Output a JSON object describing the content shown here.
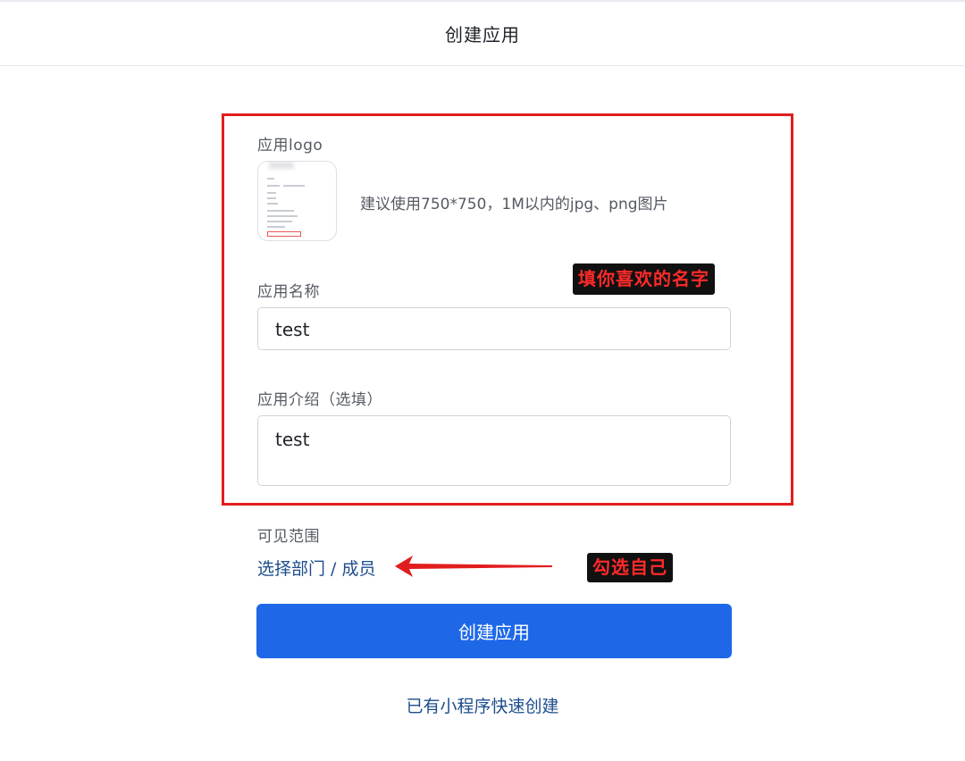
{
  "header": {
    "title": "创建应用"
  },
  "form": {
    "logo": {
      "label": "应用logo",
      "hint": "建议使用750*750，1M以内的jpg、png图片"
    },
    "name": {
      "label": "应用名称",
      "value": "test"
    },
    "intro": {
      "label": "应用介绍（选填）",
      "value": "test"
    },
    "scope": {
      "label": "可见范围",
      "link": "选择部门 / 成员"
    },
    "submit_label": "创建应用",
    "mini_program_link": "已有小程序快速创建"
  },
  "annotations": {
    "name_hint": "填你喜欢的名字",
    "scope_hint": "勾选自己"
  },
  "colors": {
    "primary": "#1e68e8",
    "link": "#1d4d8c",
    "annotation_frame": "#e21d1d",
    "annotation_text": "#ff2a2a"
  }
}
